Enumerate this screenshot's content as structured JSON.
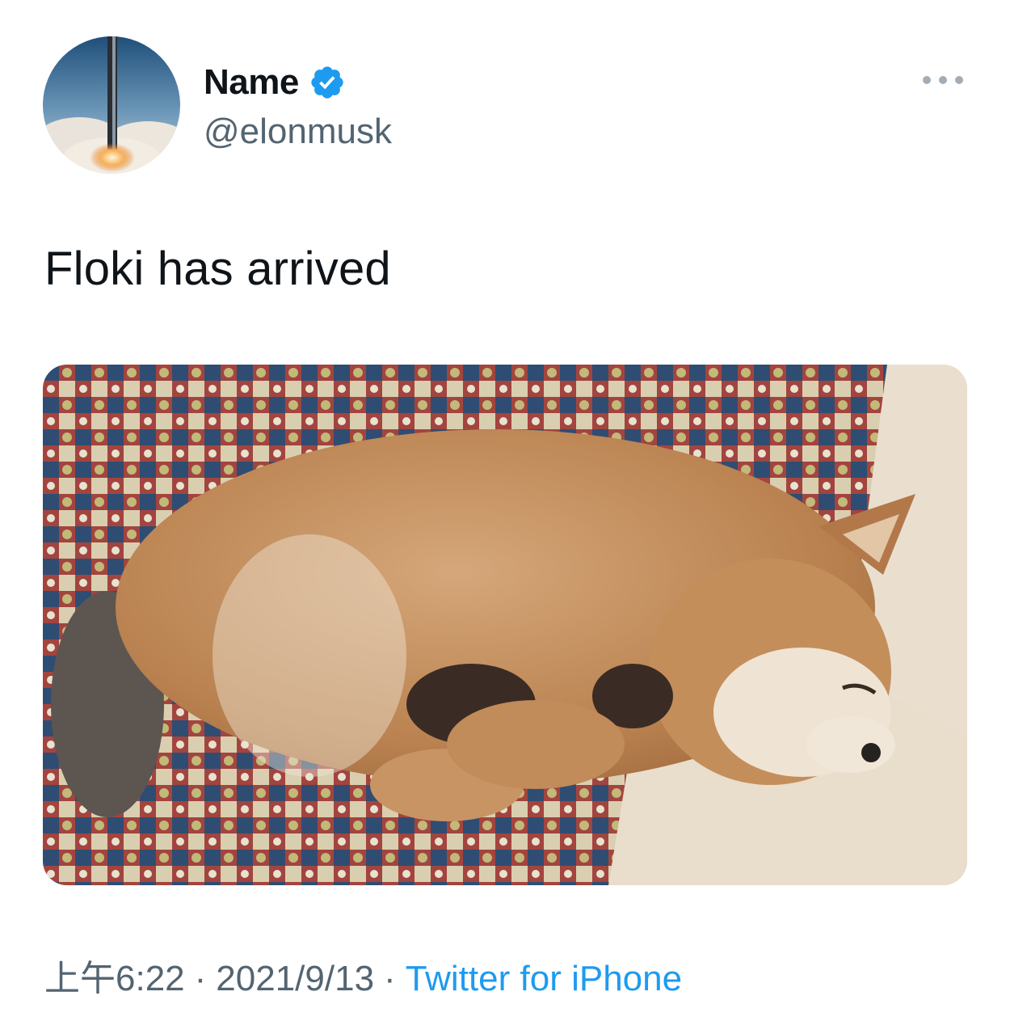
{
  "author": {
    "name": "Name",
    "handle": "@elonmusk",
    "verified": true,
    "verified_color": "#1d9bf0",
    "avatar_icon": "rocket-launch-avatar"
  },
  "more_icon": "more-options-icon",
  "tweet": {
    "text": "Floki has arrived",
    "media_description_icon": "sleeping-puppy-photo"
  },
  "meta": {
    "time": "上午6:22",
    "separator": "·",
    "date": "2021/9/13",
    "source": "Twitter for iPhone",
    "source_color": "#1d9bf0"
  }
}
